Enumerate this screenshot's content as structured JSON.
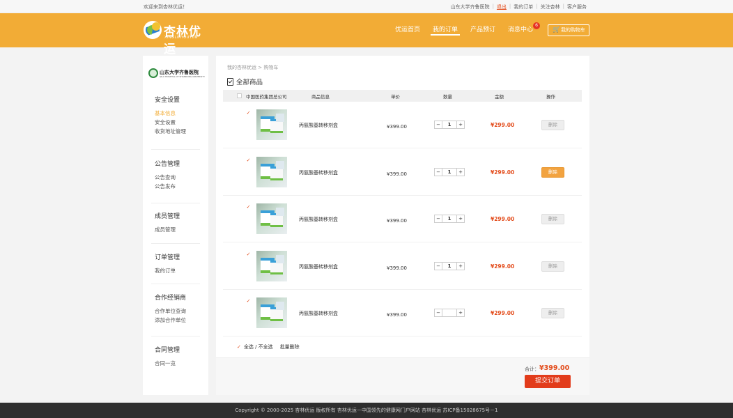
{
  "topbar": {
    "welcome": "欢迎来到杏林优运！",
    "links": [
      "山东大学齐鲁医院",
      "退出",
      "我的订单",
      "关注杏林",
      "客户服务"
    ]
  },
  "brand": {
    "name": "杏林优运",
    "pinyin": "XINGLINYOUYUN"
  },
  "nav": {
    "items": [
      "优运首页",
      "我的订单",
      "产品预订",
      "消息中心"
    ],
    "active_index": 1,
    "message_badge": "6",
    "cart_label": "我的购物车"
  },
  "sidebar": {
    "hospital_cn": "山东大学齐鲁医院",
    "hospital_en": "QILU HOSPITAL OF SHANDONG UNIVERSITY",
    "sections": [
      {
        "title": "安全设置",
        "links": [
          "基本信息",
          "安全设置",
          "收货地址管理"
        ]
      },
      {
        "title": "公告管理",
        "links": [
          "公告查询",
          "公告发布"
        ]
      },
      {
        "title": "成员管理",
        "links": [
          "成员管理"
        ]
      },
      {
        "title": "订单管理",
        "links": [
          "我的订单"
        ]
      },
      {
        "title": "合作经销商",
        "links": [
          "合作单位查询",
          "添加合作单位"
        ]
      },
      {
        "title": "合同管理",
        "links": [
          "合同一览"
        ]
      }
    ],
    "active_link": "基本信息"
  },
  "main": {
    "breadcrumb": "我的杏林优运 > 购物车",
    "section_title": "全部商品",
    "columns": [
      "中国医药集团总公司",
      "商品信息",
      "单价",
      "数量",
      "金额",
      "操作"
    ],
    "rows": [
      {
        "name": "丙氨酸基转移剂盒",
        "price": "¥399.00",
        "qty": "1",
        "amount": "¥299.00",
        "action": "删除",
        "hover": false
      },
      {
        "name": "丙氨酸基转移剂盒",
        "price": "¥399.00",
        "qty": "1",
        "amount": "¥299.00",
        "action": "删除",
        "hover": true
      },
      {
        "name": "丙氨酸基转移剂盒",
        "price": "¥399.00",
        "qty": "1",
        "amount": "¥299.00",
        "action": "删除",
        "hover": false
      },
      {
        "name": "丙氨酸基转移剂盒",
        "price": "¥399.00",
        "qty": "1",
        "amount": "¥299.00",
        "action": "删除",
        "hover": false
      },
      {
        "name": "丙氨酸基转移剂盒",
        "price": "¥399.00",
        "qty": "",
        "amount": "¥299.00",
        "action": "删除",
        "hover": false
      }
    ],
    "select_all": "全选 / 不全选",
    "batch_delete": "批量删除",
    "total_label": "合计：",
    "total_value": "¥399.00",
    "submit": "提交订单"
  },
  "footer": "Copyright © 2000-2025 杏林优运 版权所有 杏林优运－中国领先的健康网门户网站 杏林优运 苏ICP备15028675号－1",
  "colors": {
    "header": "#f2ac36",
    "accent": "#e34d1d",
    "submit": "#e23c1b"
  }
}
